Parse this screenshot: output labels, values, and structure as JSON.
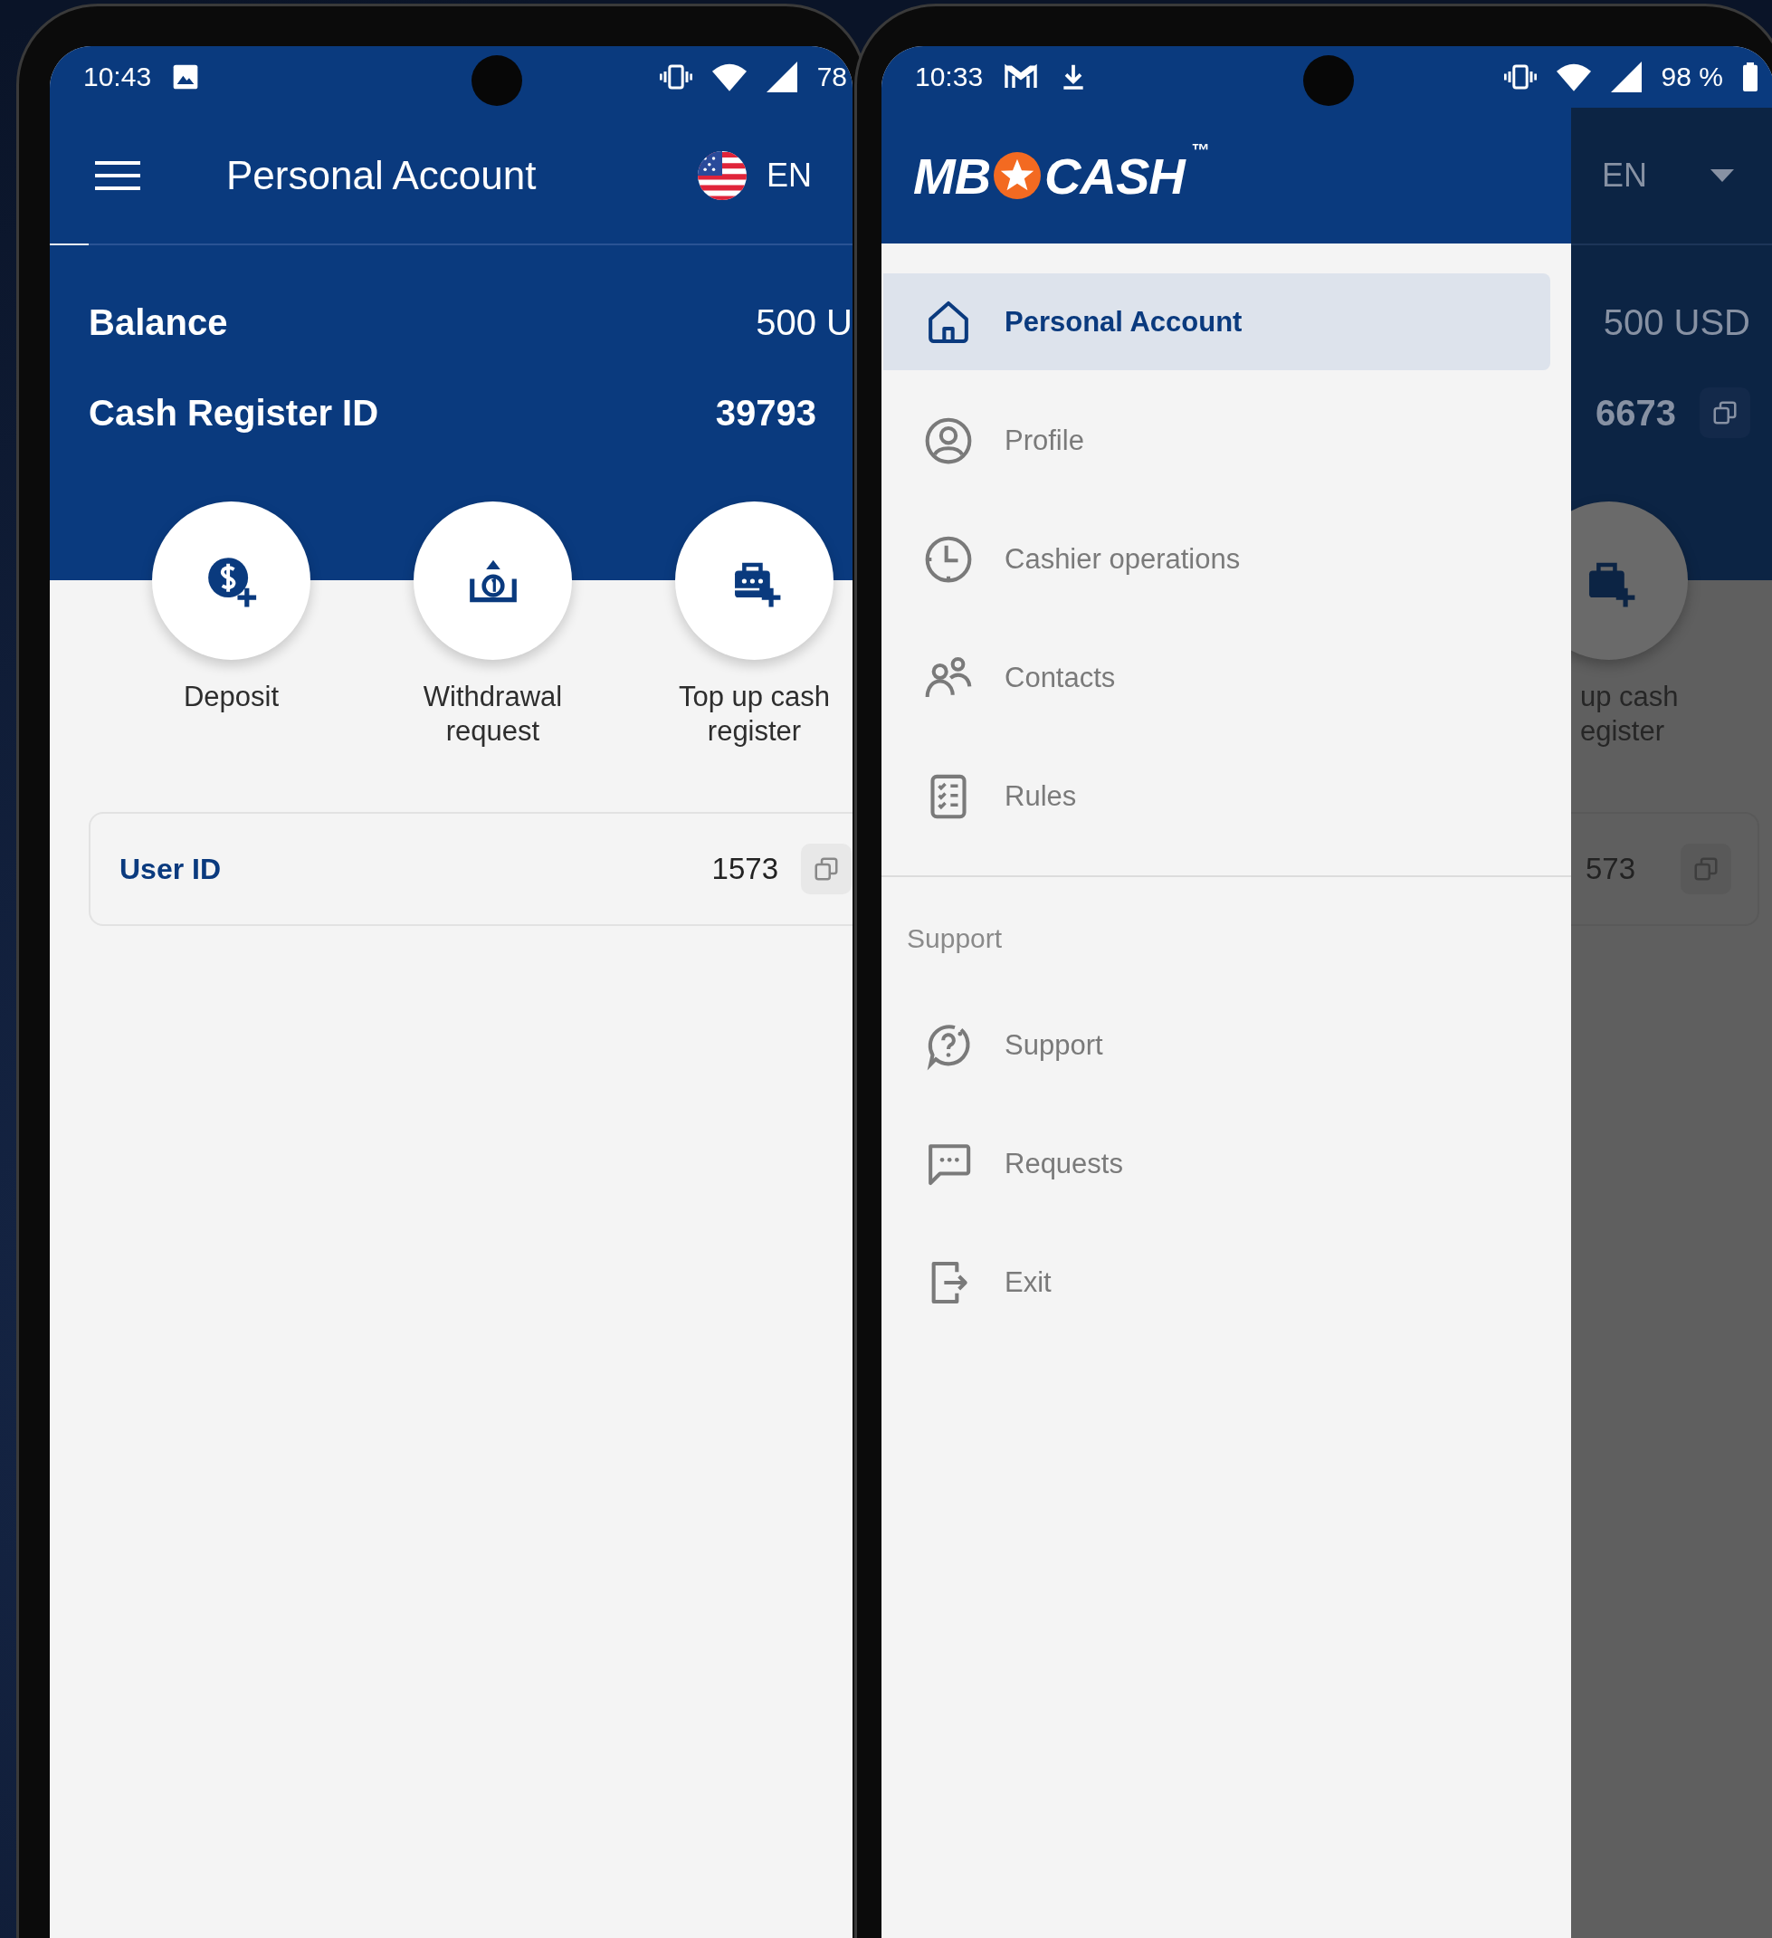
{
  "left_phone": {
    "status_bar": {
      "time": "10:43",
      "battery": "78"
    },
    "app_bar": {
      "title": "Personal Account",
      "language": "EN"
    },
    "balance": {
      "label": "Balance",
      "value": "500 U"
    },
    "cash_register": {
      "label": "Cash Register ID",
      "value": "39793"
    },
    "actions": [
      {
        "label": "Deposit"
      },
      {
        "label": "Withdrawal request"
      },
      {
        "label": "Top up cash register"
      }
    ],
    "user_id": {
      "label": "User ID",
      "value": "1573"
    }
  },
  "right_phone": {
    "status_bar": {
      "time": "10:33",
      "battery": "98 %"
    },
    "background": {
      "language": "EN",
      "balance": "500 USD",
      "cash_register": "6673",
      "action_label_lines": [
        "up cash",
        "egister"
      ],
      "user_id": "573"
    },
    "drawer": {
      "logo": {
        "left": "MB",
        "right": "CASH",
        "mark": "™"
      },
      "sections": [
        {
          "items": [
            {
              "label": "Personal Account",
              "selected": true
            },
            {
              "label": "Profile",
              "selected": false
            },
            {
              "label": "Cashier operations",
              "selected": false
            },
            {
              "label": "Contacts",
              "selected": false
            },
            {
              "label": "Rules",
              "selected": false
            }
          ]
        },
        {
          "title": "Support",
          "items": [
            {
              "label": "Support",
              "selected": false
            },
            {
              "label": "Requests",
              "selected": false
            },
            {
              "label": "Exit",
              "selected": false
            }
          ]
        }
      ]
    }
  }
}
